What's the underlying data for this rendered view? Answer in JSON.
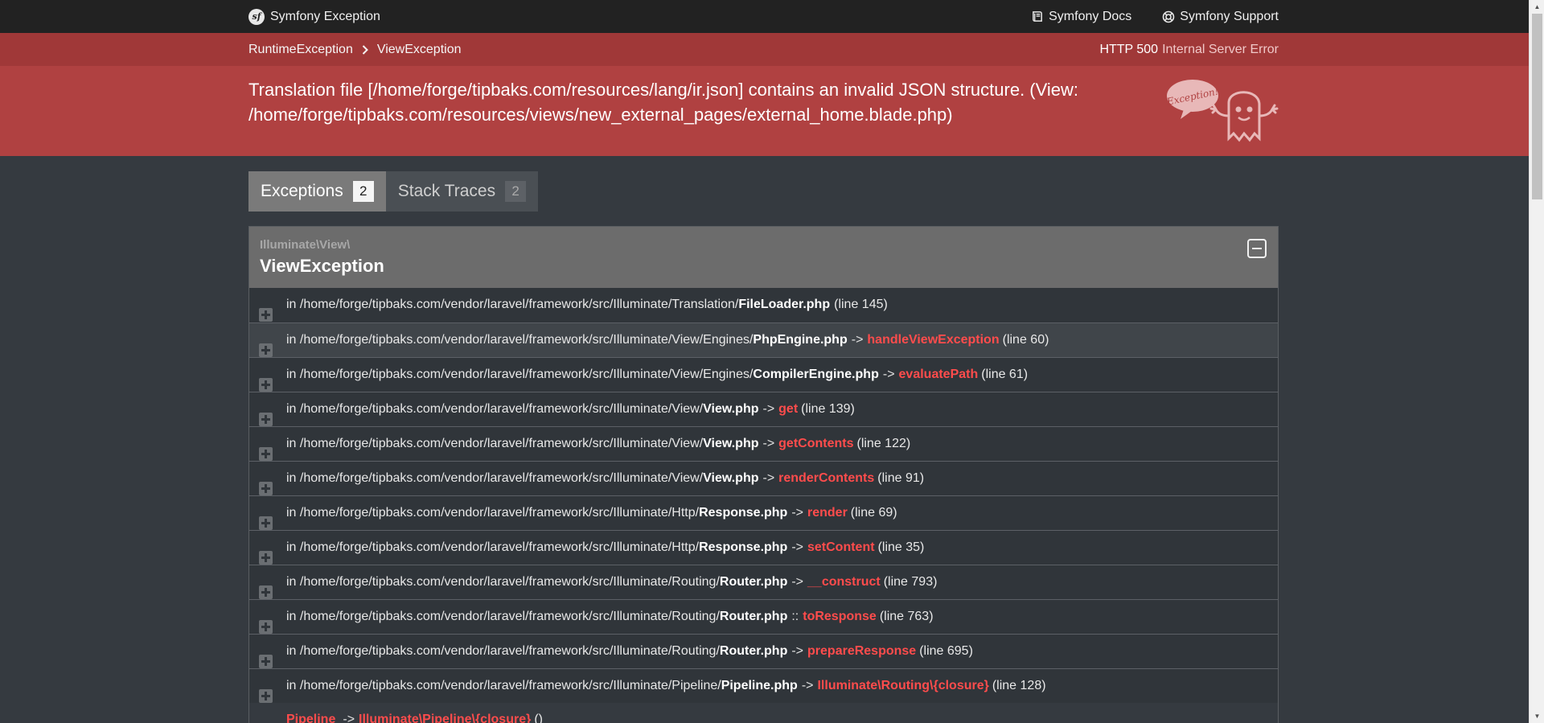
{
  "header": {
    "brand": "Symfony Exception",
    "docs_label": "Symfony Docs",
    "support_label": "Symfony Support"
  },
  "breadcrumb": {
    "items": [
      "RuntimeException",
      "ViewException"
    ]
  },
  "status": {
    "code": "HTTP 500",
    "text": "Internal Server Error"
  },
  "message": "Translation file [/home/forge/tipbaks.com/resources/lang/ir.json] contains an invalid JSON structure. (View: /home/forge/tipbaks.com/resources/views/new_external_pages/external_home.blade.php)",
  "ghost_label": "Exception!",
  "tabs": [
    {
      "label": "Exceptions",
      "count": "2"
    },
    {
      "label": "Stack Traces",
      "count": "2"
    }
  ],
  "exception": {
    "namespace": "Illuminate\\View\\",
    "class": "ViewException"
  },
  "trace": [
    {
      "prefix": "in /home/forge/tipbaks.com/vendor/laravel/framework/src/Illuminate/Translation/",
      "file": "FileLoader.php",
      "op": "",
      "fn": "",
      "line": "(line 145)"
    },
    {
      "prefix": "in /home/forge/tipbaks.com/vendor/laravel/framework/src/Illuminate/View/Engines/",
      "file": "PhpEngine.php",
      "op": "->",
      "fn": "handleViewException",
      "line": "(line 60)"
    },
    {
      "prefix": "in /home/forge/tipbaks.com/vendor/laravel/framework/src/Illuminate/View/Engines/",
      "file": "CompilerEngine.php",
      "op": "->",
      "fn": "evaluatePath",
      "line": "(line 61)"
    },
    {
      "prefix": "in /home/forge/tipbaks.com/vendor/laravel/framework/src/Illuminate/View/",
      "file": "View.php",
      "op": "->",
      "fn": "get",
      "line": "(line 139)"
    },
    {
      "prefix": "in /home/forge/tipbaks.com/vendor/laravel/framework/src/Illuminate/View/",
      "file": "View.php",
      "op": "->",
      "fn": "getContents",
      "line": "(line 122)"
    },
    {
      "prefix": "in /home/forge/tipbaks.com/vendor/laravel/framework/src/Illuminate/View/",
      "file": "View.php",
      "op": "->",
      "fn": "renderContents",
      "line": "(line 91)"
    },
    {
      "prefix": "in /home/forge/tipbaks.com/vendor/laravel/framework/src/Illuminate/Http/",
      "file": "Response.php",
      "op": "->",
      "fn": "render",
      "line": "(line 69)"
    },
    {
      "prefix": "in /home/forge/tipbaks.com/vendor/laravel/framework/src/Illuminate/Http/",
      "file": "Response.php",
      "op": "->",
      "fn": "setContent",
      "line": "(line 35)"
    },
    {
      "prefix": "in /home/forge/tipbaks.com/vendor/laravel/framework/src/Illuminate/Routing/",
      "file": "Router.php",
      "op": "->",
      "fn": "__construct",
      "line": "(line 793)"
    },
    {
      "prefix": "in /home/forge/tipbaks.com/vendor/laravel/framework/src/Illuminate/Routing/",
      "file": "Router.php",
      "op": "::",
      "fn": "toResponse",
      "line": "(line 763)"
    },
    {
      "prefix": "in /home/forge/tipbaks.com/vendor/laravel/framework/src/Illuminate/Routing/",
      "file": "Router.php",
      "op": "->",
      "fn": "prepareResponse",
      "line": "(line 695)"
    },
    {
      "prefix": "in /home/forge/tipbaks.com/vendor/laravel/framework/src/Illuminate/Pipeline/",
      "file": "Pipeline.php",
      "op": "->",
      "fn": "Illuminate\\Routing\\{closure}",
      "line": "(line 128)"
    }
  ],
  "trace_cut": {
    "fn_a": "Pipeline",
    "op": "->",
    "fn_b": "Illuminate\\Pipeline\\{closure}",
    "suffix": "()"
  }
}
